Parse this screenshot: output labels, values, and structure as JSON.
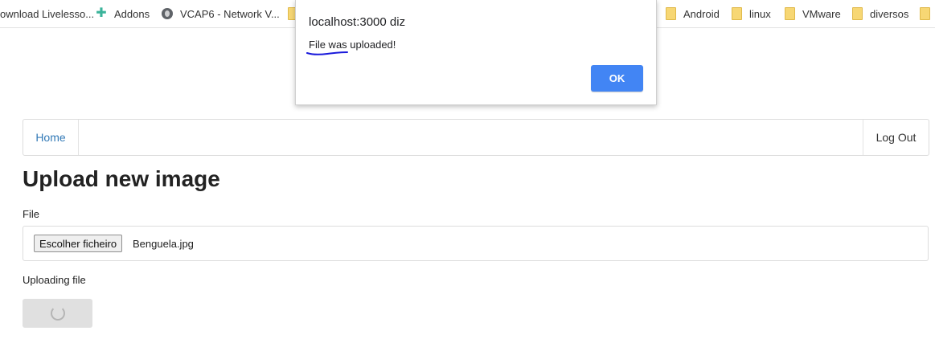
{
  "bookmarks": [
    {
      "label": "ownload Livelesso...",
      "icon": "none"
    },
    {
      "label": "Addons",
      "icon": "puzzle-icon"
    },
    {
      "label": "VCAP6 - Network V...",
      "icon": "globe-icon"
    },
    {
      "label": "",
      "icon": "folder-icon"
    },
    {
      "label": "Android",
      "icon": "folder-icon"
    },
    {
      "label": "linux",
      "icon": "folder-icon"
    },
    {
      "label": "VMware",
      "icon": "folder-icon"
    },
    {
      "label": "diversos",
      "icon": "folder-icon"
    },
    {
      "label": "",
      "icon": "folder-icon"
    }
  ],
  "dialog": {
    "title": "localhost:3000 diz",
    "message": "File was uploaded!",
    "ok_label": "OK",
    "annotation_color": "#1a1adb"
  },
  "navbar": {
    "home_label": "Home",
    "logout_label": "Log Out"
  },
  "main": {
    "title": "Upload new image",
    "file_label": "File",
    "choose_button_label": "Escolher ficheiro",
    "selected_file": "Benguela.jpg",
    "status_text": "Uploading file"
  },
  "colors": {
    "link": "#337ab7",
    "ok_button": "#4285f4",
    "disabled_button": "#e0e0e0"
  }
}
